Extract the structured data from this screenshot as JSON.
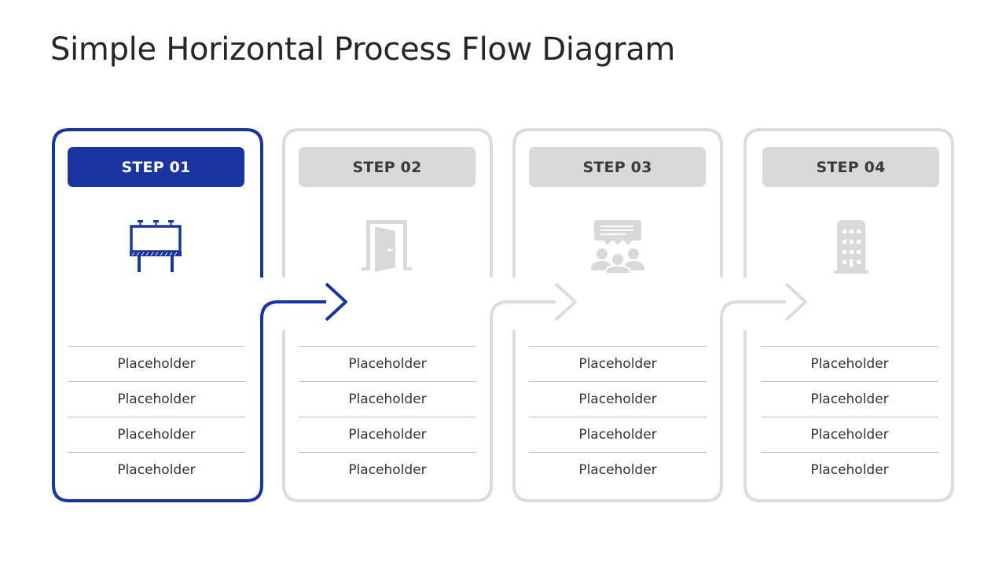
{
  "title": "Simple Horizontal Process Flow Diagram",
  "colors": {
    "active": "#1a35a0",
    "inactive": "#d9d9d9",
    "text": "#333333"
  },
  "steps": [
    {
      "label": "STEP 01",
      "state": "active",
      "icon": "billboard-icon",
      "items": [
        "Placeholder",
        "Placeholder",
        "Placeholder",
        "Placeholder"
      ]
    },
    {
      "label": "STEP 02",
      "state": "inactive",
      "icon": "door-icon",
      "items": [
        "Placeholder",
        "Placeholder",
        "Placeholder",
        "Placeholder"
      ]
    },
    {
      "label": "STEP 03",
      "state": "inactive",
      "icon": "meeting-icon",
      "items": [
        "Placeholder",
        "Placeholder",
        "Placeholder",
        "Placeholder"
      ]
    },
    {
      "label": "STEP 04",
      "state": "inactive",
      "icon": "building-icon",
      "items": [
        "Placeholder",
        "Placeholder",
        "Placeholder",
        "Placeholder"
      ]
    }
  ]
}
